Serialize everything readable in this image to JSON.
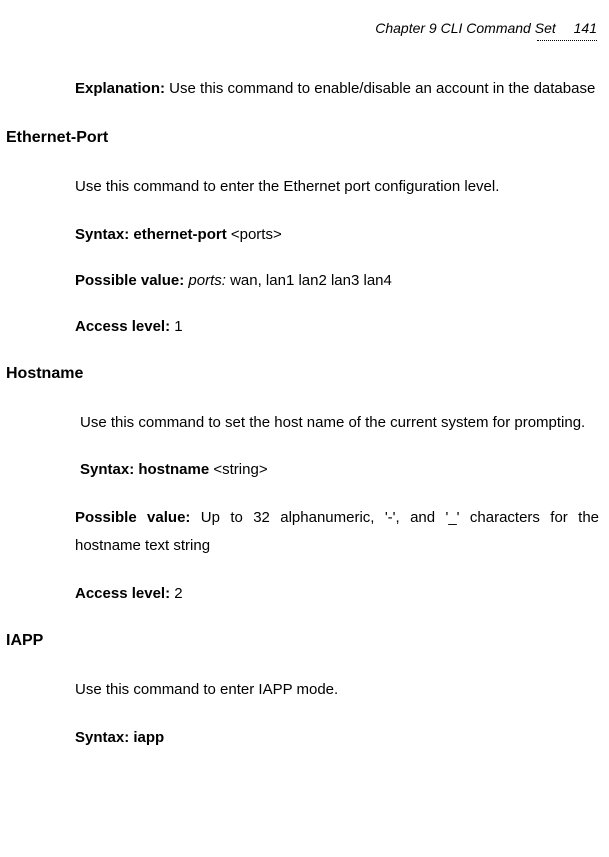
{
  "header": {
    "chapter": "Chapter 9 CLI Command Set",
    "page": "141"
  },
  "intro": {
    "explanation_label": "Explanation:",
    "explanation_text": " Use this command to enable/disable an account in the database"
  },
  "sections": {
    "ethernet": {
      "heading": "Ethernet-Port",
      "desc": "Use this command to enter the Ethernet port configuration level.",
      "syntax_label": "Syntax: ethernet-port ",
      "syntax_arg": "<ports>",
      "possible_label": "Possible value: ",
      "possible_param": "ports:",
      "possible_text": " wan, lan1 lan2 lan3 lan4",
      "access_label": "Access level: ",
      "access_value": "1"
    },
    "hostname": {
      "heading": "Hostname",
      "desc": "Use this command to set the host name of the current system for prompting.",
      "syntax_label": "Syntax: hostname ",
      "syntax_arg": "<string>",
      "possible_label": "Possible value: ",
      "possible_text": "Up to 32 alphanumeric, '-', and '_' characters for the hostname text string",
      "access_label": "Access level: ",
      "access_value": "2"
    },
    "iapp": {
      "heading": "IAPP",
      "desc": "Use this command to enter IAPP mode.",
      "syntax_label": "Syntax: iapp"
    }
  }
}
